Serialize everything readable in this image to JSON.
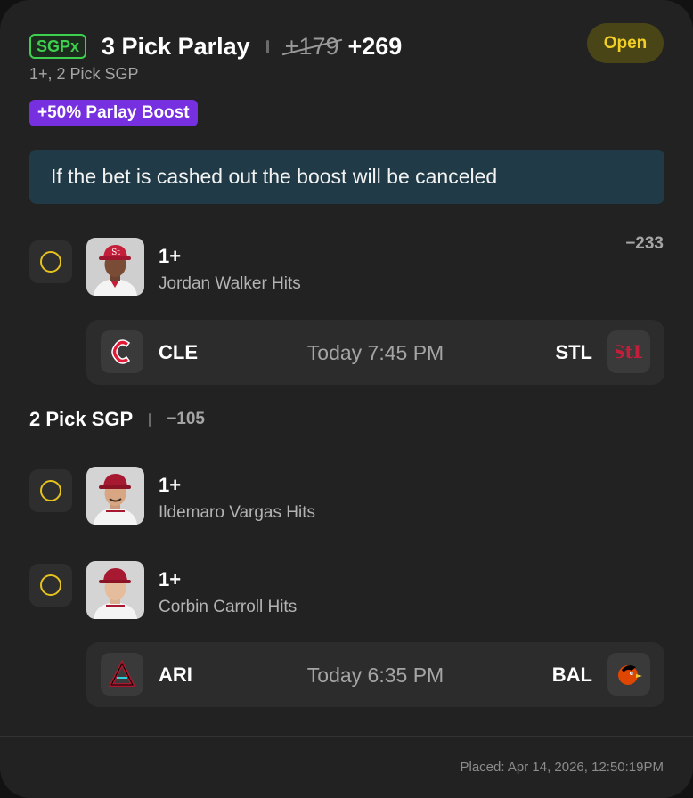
{
  "bet": {
    "badge": "SGPx",
    "title": "3 Pick Parlay",
    "old_odds": "+179",
    "new_odds": "+269",
    "status": "Open",
    "subtitle": "1+, 2 Pick SGP",
    "boost_label": "+50% Parlay Boost",
    "notice": "If the bet is cashed out the boost will be canceled"
  },
  "legs": [
    {
      "line": "1+",
      "description": "Jordan Walker Hits",
      "odds": "−233"
    },
    {
      "line": "1+",
      "description": "Ildemaro Vargas Hits",
      "odds": ""
    },
    {
      "line": "1+",
      "description": "Corbin Carroll Hits",
      "odds": ""
    }
  ],
  "games": [
    {
      "away": "CLE",
      "home": "STL",
      "time": "Today 7:45 PM",
      "away_icon": "guardians-logo-icon",
      "home_icon": "cardinals-logo-icon"
    },
    {
      "away": "ARI",
      "home": "BAL",
      "time": "Today 6:35 PM",
      "away_icon": "diamondbacks-logo-icon",
      "home_icon": "orioles-logo-icon"
    }
  ],
  "sgp": {
    "title": "2 Pick SGP",
    "odds": "−105"
  },
  "footer": {
    "placed": "Placed: Apr 14, 2026, 12:50:19PM"
  },
  "colors": {
    "card_bg": "#222222",
    "accent_green": "#3fcf4e",
    "status_yellow": "#f1cf24",
    "boost_purple": "#7630e0",
    "notice_bg": "#203b47"
  }
}
